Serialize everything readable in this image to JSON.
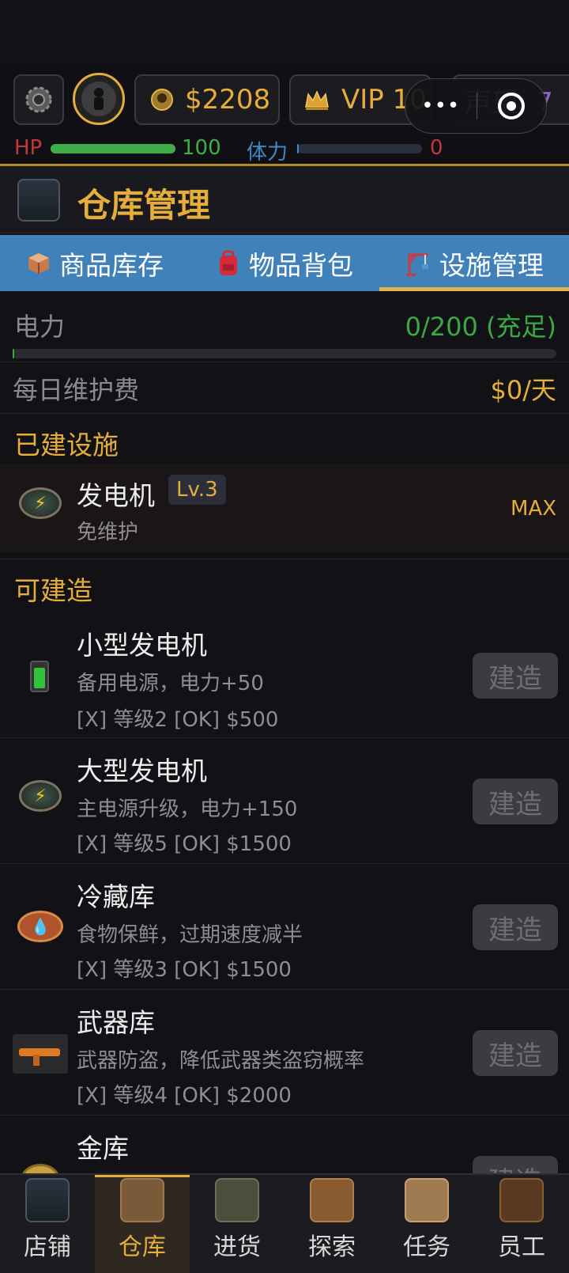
{
  "hud": {
    "money": "$2208",
    "vip": "VIP 10",
    "reputation": "声望: 7",
    "hp_label": "HP",
    "hp_value": "100",
    "hp_fraction": 1.0,
    "stamina_label": "体力",
    "stamina_value": "0",
    "stamina_fraction": 0.0,
    "capsule_more": "•••"
  },
  "header": {
    "title": "仓库管理"
  },
  "tabs": [
    {
      "label": "商品库存",
      "icon": "box-icon",
      "active": false
    },
    {
      "label": "物品背包",
      "icon": "backpack-icon",
      "active": false
    },
    {
      "label": "设施管理",
      "icon": "crane-icon",
      "active": true
    }
  ],
  "power": {
    "label": "电力",
    "value": "0/200 (充足)",
    "fraction": 0.0
  },
  "maintenance": {
    "label": "每日维护费",
    "value": "$0/天"
  },
  "built_section": {
    "title": "已建设施",
    "items": [
      {
        "name": "发电机",
        "level": "Lv.3",
        "desc": "免维护",
        "status": "MAX",
        "icon": "energy-icon"
      }
    ]
  },
  "buildable_section": {
    "title": "可建造",
    "button_label": "建造",
    "items": [
      {
        "name": "小型发电机",
        "desc": "备用电源，电力+50",
        "req": "[X] 等级2  [OK] $500",
        "icon": "battery-icon"
      },
      {
        "name": "大型发电机",
        "desc": "主电源升级，电力+150",
        "req": "[X] 等级5  [OK] $1500",
        "icon": "energy-icon"
      },
      {
        "name": "冷藏库",
        "desc": "食物保鲜，过期速度减半",
        "req": "[X] 等级3  [OK] $1500",
        "icon": "water-drop-icon"
      },
      {
        "name": "武器库",
        "desc": "武器防盗，降低武器类盗窃概率",
        "req": "[X] 等级4  [OK] $2000",
        "icon": "gun-icon"
      },
      {
        "name": "金库",
        "icon": "coin-icon"
      }
    ]
  },
  "nav": [
    {
      "label": "店铺",
      "active": false
    },
    {
      "label": "仓库",
      "active": true
    },
    {
      "label": "进货",
      "active": false
    },
    {
      "label": "探索",
      "active": false
    },
    {
      "label": "任务",
      "active": false
    },
    {
      "label": "员工",
      "active": false
    }
  ],
  "colors": {
    "accent_gold": "#e5ad3a",
    "tab_blue": "#3f81b8",
    "hp_green": "#3fae4a",
    "stamina_blue": "#3d88c9",
    "power_green": "#3aa845"
  }
}
